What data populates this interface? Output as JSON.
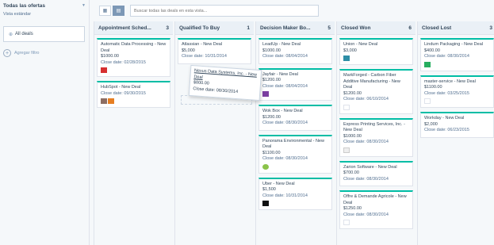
{
  "sidebar": {
    "title": "Todas las ofertas",
    "subtitle": "Vista estándar",
    "filter_label": "All deals",
    "add_filter": "Agregar filtro"
  },
  "toolbar": {
    "search_placeholder": "Buscar todas las deals en esta vista..."
  },
  "columns": [
    {
      "title": "Appointment Sched...",
      "count": "3",
      "cards": [
        {
          "name": "Automatic Data Processing - New Deal",
          "amount": "$1000.00",
          "close": "Close date: 02/28/2015",
          "logo": "red"
        },
        {
          "name": "HubSpot - New Deal",
          "amount": "",
          "close": "Close date: 09/30/2015",
          "logo": "multi"
        }
      ]
    },
    {
      "title": "Qualified To Buy",
      "count": "1",
      "cards": [
        {
          "name": "Atlassian - New Deal",
          "amount": "$5,000",
          "close": "Close date: 10/31/2014",
          "logo": ""
        }
      ]
    },
    {
      "title": "Decision Maker Bo...",
      "count": "5",
      "cards": [
        {
          "name": "LeadUp - New Deal",
          "amount": "$1000.00",
          "close": "Close date: 08/04/2014",
          "logo": ""
        },
        {
          "name": "Jayfair - New Deal",
          "amount": "$1200.00",
          "close": "Close date: 08/04/2014",
          "logo": "purple"
        },
        {
          "name": "Wok Box - New Deal",
          "amount": "$1200.00",
          "close": "Close date: 08/30/2014",
          "logo": ""
        },
        {
          "name": "Panorama Environmental - New Deal",
          "amount": "$1100.00",
          "close": "Close date: 08/30/2014",
          "logo": "lime"
        },
        {
          "name": "Uber - New Deal",
          "amount": "$1,500",
          "close": "Close date: 10/31/2014",
          "logo": "black"
        }
      ]
    },
    {
      "title": "Closed Won",
      "count": "6",
      "cards": [
        {
          "name": "Union - New Deal",
          "amount": "$3,000",
          "close": "",
          "logo": "teal"
        },
        {
          "name": "MarkForged - Carbon Fiber Additive Manufacturing - New Deal",
          "amount": "$1200.00",
          "close": "Close date: 06/10/2014",
          "logo": "empty"
        },
        {
          "name": "Express Printing Services, Inc. - New Deal",
          "amount": "$1000.00",
          "close": "Close date: 08/30/2014",
          "logo": "gray"
        },
        {
          "name": "Zarion Software - New Deal",
          "amount": "$700.00",
          "close": "Close date: 08/30/2014",
          "logo": ""
        },
        {
          "name": "Offre & Demande Agricole - New Deal",
          "amount": "$1250.00",
          "close": "Close date: 08/30/2014",
          "logo": "empty"
        }
      ]
    },
    {
      "title": "Closed Lost",
      "count": "3",
      "cards": [
        {
          "name": "Lindum Packaging - New Deal",
          "amount": "$400.00",
          "close": "Close date: 08/30/2014",
          "logo": "green"
        },
        {
          "name": "master-service - New Deal",
          "amount": "$1100.00",
          "close": "Close date: 03/25/2015",
          "logo": "empty"
        },
        {
          "name": "Workday - New Deal",
          "amount": "$2,000",
          "close": "Close date: 06/23/2015",
          "logo": ""
        }
      ]
    }
  ],
  "dragging": {
    "name": "Nexus Data Systems, Inc. - New Deal",
    "amount": "$800.00",
    "close": "Close date: 08/30/2014"
  }
}
